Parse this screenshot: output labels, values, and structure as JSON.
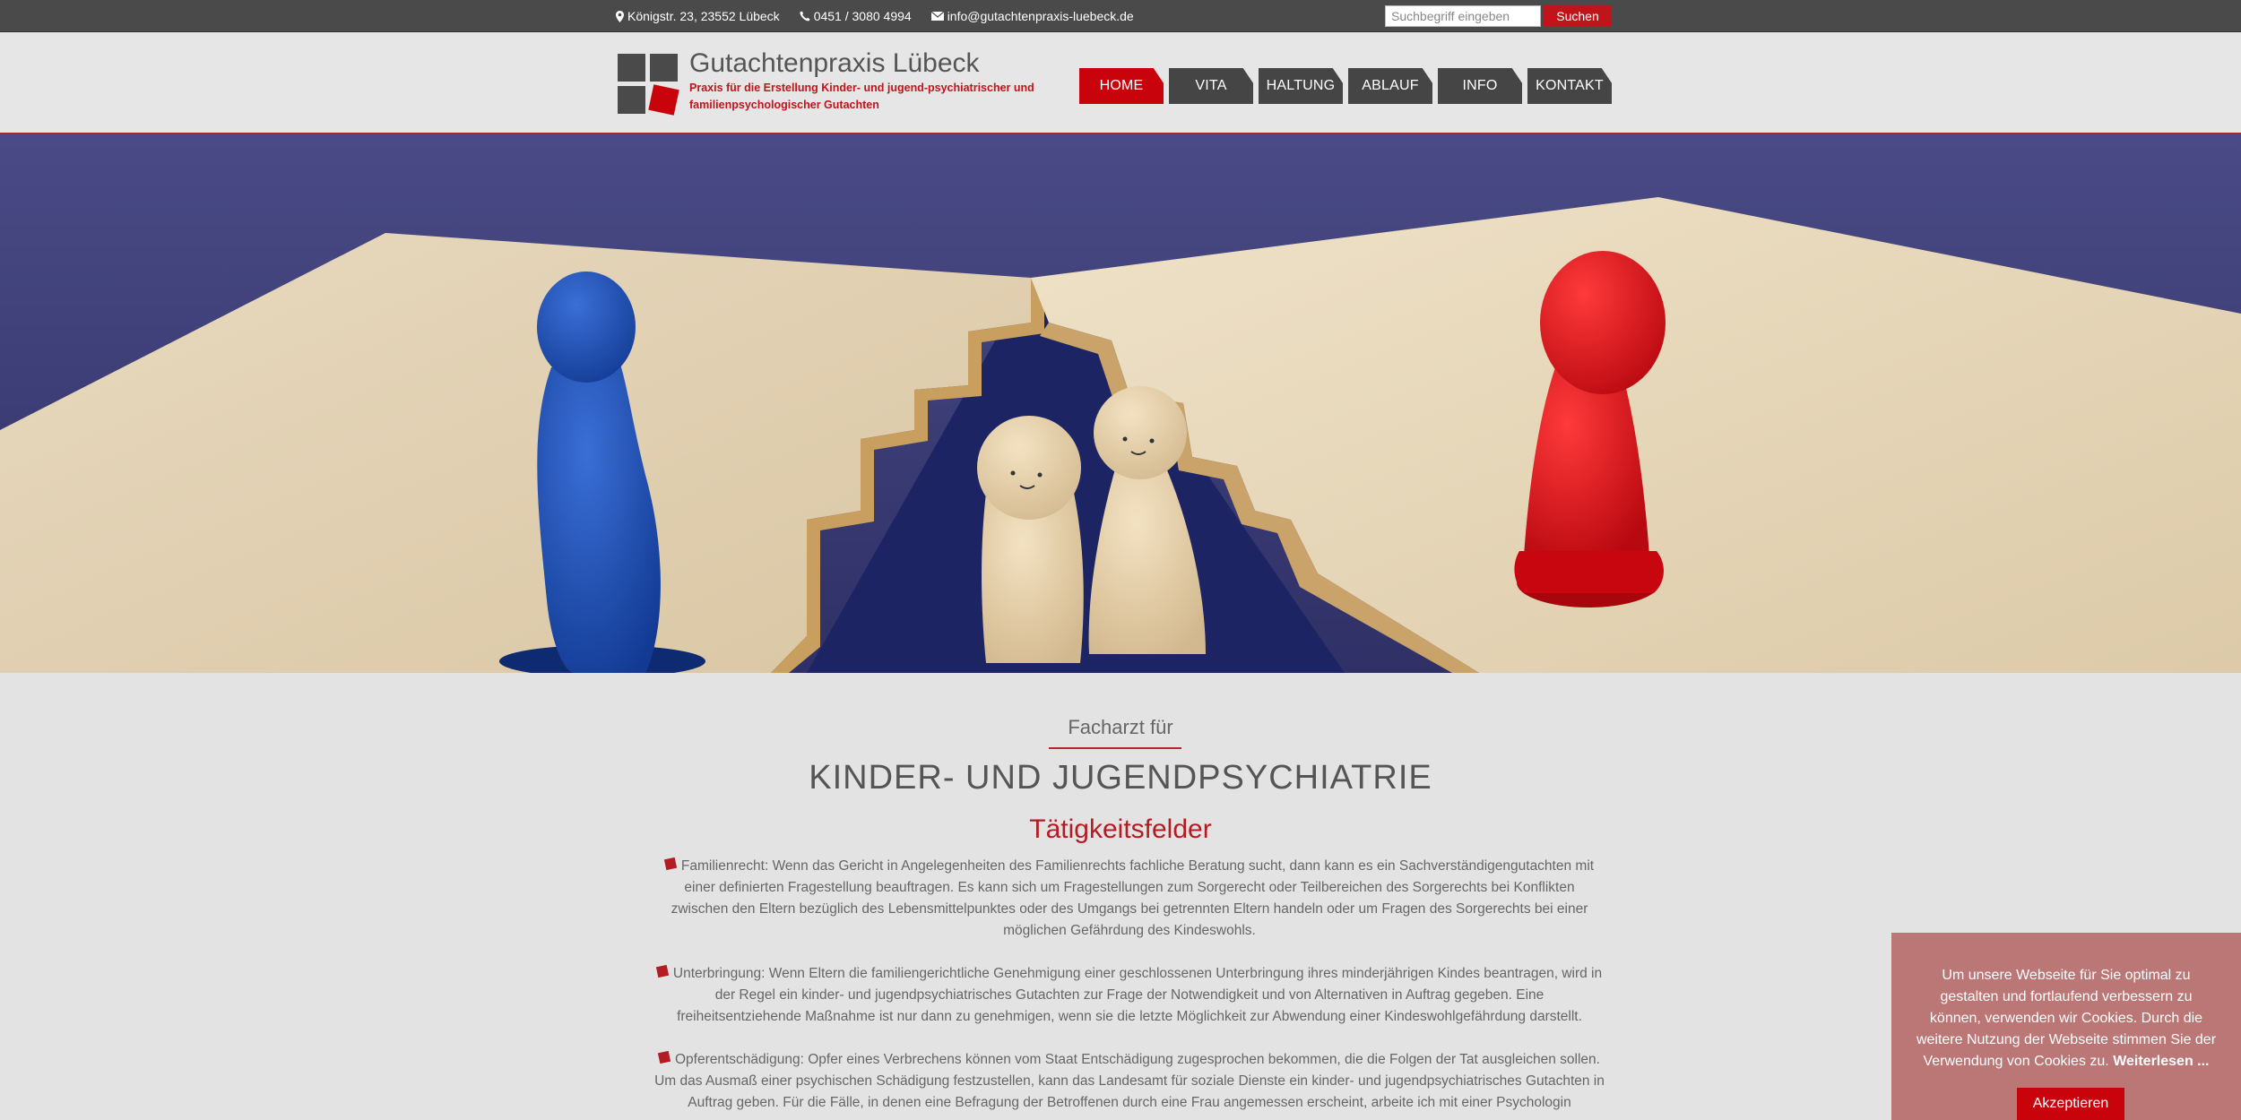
{
  "topbar": {
    "address": "Königstr. 23, 23552 Lübeck",
    "phone": "0451 / 3080 4994",
    "email": "info@gutachtenpraxis-luebeck.de",
    "search_placeholder": "Suchbegriff eingeben",
    "search_button": "Suchen",
    "icons": [
      "map-marker-icon",
      "phone-icon",
      "envelope-icon"
    ]
  },
  "header": {
    "title": "Gutachtenpraxis Lübeck",
    "subtitle": "Praxis für die Erstellung Kinder- und jugend-psychiatrischer und familienpsychologischer Gutachten",
    "colors": {
      "brand_red": "#c8030c",
      "nav_dark": "#454545"
    }
  },
  "nav": {
    "items": [
      {
        "label": "HOME",
        "active": true
      },
      {
        "label": "VITA",
        "active": false
      },
      {
        "label": "HALTUNG",
        "active": false
      },
      {
        "label": "ABLAUF",
        "active": false
      },
      {
        "label": "INFO",
        "active": false
      },
      {
        "label": "KONTAKT",
        "active": false
      }
    ]
  },
  "content": {
    "pre_title": "Facharzt für",
    "main_title": "KINDER- UND JUGENDPSYCHIATRIE",
    "section_title": "Tätigkeitsfelder",
    "paragraphs": [
      "Familienrecht: Wenn das Gericht in Angelegenheiten des Familienrechts fachliche Beratung sucht, dann kann es ein Sachverständigengutachten mit einer definierten Fragestellung beauftragen. Es kann sich um Fragestellungen zum Sorgerecht oder Teilbereichen des Sorgerechts bei Konflikten zwischen den Eltern bezüglich des Lebensmittelpunktes oder des Umgangs bei getrennten Eltern handeln oder um Fragen des Sorgerechts bei einer möglichen Gefährdung des Kindeswohls.",
      "Unterbringung: Wenn Eltern die familiengerichtliche Genehmigung einer geschlossenen Unterbringung ihres minderjährigen Kindes beantragen, wird in der Regel ein kinder- und jugendpsychiatrisches Gutachten zur Frage der Notwendigkeit und von Alternativen in Auftrag gegeben. Eine freiheitsentziehende Maßnahme ist nur dann zu genehmigen, wenn sie die letzte Möglichkeit zur Abwendung einer Kindeswohlgefährdung darstellt.",
      "Opferentschädigung: Opfer eines Verbrechens können vom Staat Entschädigung zugesprochen bekommen, die die Folgen der Tat ausgleichen sollen. Um das Ausmaß einer psychischen Schädigung festzustellen, kann das Landesamt für soziale Dienste ein kinder- und jugendpsychiatrisches Gutachten in Auftrag geben. Für die Fälle, in denen eine Befragung der Betroffenen durch eine Frau angemessen erscheint, arbeite ich mit einer Psychologin zusammen."
    ]
  },
  "cookie": {
    "text": "Um unsere Webseite für Sie optimal zu gestalten und fortlaufend verbessern zu können, verwenden wir Cookies. Durch die weitere Nutzung der Webseite stimmen Sie der Verwendung von Cookies zu.",
    "more_link": "Weiterlesen ...",
    "accept": "Akzeptieren"
  }
}
